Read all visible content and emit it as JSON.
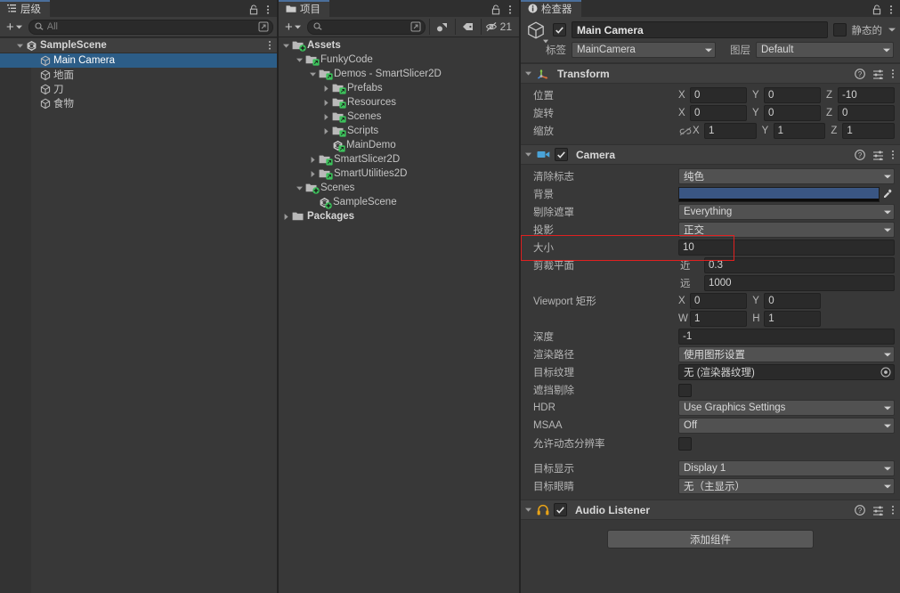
{
  "hierarchy": {
    "tab_label": "层级",
    "tab_icon": "hierarchy-icon",
    "lock_icon": "lock-icon",
    "menu_icon": "kebab-menu-icon",
    "create_label": "+",
    "search_placeholder": "All",
    "search_value": "",
    "items": [
      {
        "label": "SampleScene",
        "icon": "unity-scene-icon",
        "depth": 0,
        "expanded": true,
        "selected": false,
        "bold": true
      },
      {
        "label": "Main Camera",
        "icon": "gameobject-cube-icon",
        "depth": 1,
        "expanded": null,
        "selected": true,
        "bold": false
      },
      {
        "label": "地面",
        "icon": "gameobject-cube-icon",
        "depth": 1,
        "expanded": null,
        "selected": false,
        "bold": false
      },
      {
        "label": "刀",
        "icon": "gameobject-cube-icon",
        "depth": 1,
        "expanded": null,
        "selected": false,
        "bold": false
      },
      {
        "label": "食物",
        "icon": "gameobject-cube-icon",
        "depth": 1,
        "expanded": null,
        "selected": false,
        "bold": false
      }
    ]
  },
  "project": {
    "tab_label": "项目",
    "tab_icon": "folder-icon",
    "lock_icon": "lock-icon",
    "menu_icon": "kebab-menu-icon",
    "create_label": "+",
    "search_placeholder": "",
    "search_value": "",
    "toolbar_icons": [
      "search-expand-icon",
      "filter-by-type-icon",
      "filter-by-label-icon"
    ],
    "hidden_count": "21",
    "hidden_count_icon": "eye-slash-icon",
    "items": [
      {
        "label": "Assets",
        "icon": "folder-assets-icon",
        "depth": 0,
        "expanded": true,
        "bold": true
      },
      {
        "label": "FunkyCode",
        "icon": "folder-package-icon",
        "depth": 1,
        "expanded": true,
        "bold": false
      },
      {
        "label": "Demos - SmartSlicer2D",
        "icon": "folder-package-icon",
        "depth": 2,
        "expanded": true,
        "bold": false
      },
      {
        "label": "Prefabs",
        "icon": "folder-package-icon",
        "depth": 3,
        "expanded": false,
        "bold": false
      },
      {
        "label": "Resources",
        "icon": "folder-package-icon",
        "depth": 3,
        "expanded": false,
        "bold": false
      },
      {
        "label": "Scenes",
        "icon": "folder-package-icon",
        "depth": 3,
        "expanded": false,
        "bold": false
      },
      {
        "label": "Scripts",
        "icon": "folder-package-icon",
        "depth": 3,
        "expanded": false,
        "bold": false
      },
      {
        "label": "MainDemo",
        "icon": "unity-scene-icon",
        "depth": 3,
        "expanded": null,
        "bold": false
      },
      {
        "label": "SmartSlicer2D",
        "icon": "folder-package-icon",
        "depth": 2,
        "expanded": false,
        "bold": false
      },
      {
        "label": "SmartUtilities2D",
        "icon": "folder-package-icon",
        "depth": 2,
        "expanded": false,
        "bold": false
      },
      {
        "label": "Scenes",
        "icon": "folder-assets-icon",
        "depth": 1,
        "expanded": true,
        "bold": false
      },
      {
        "label": "SampleScene",
        "icon": "unity-scene-icon",
        "depth": 2,
        "expanded": null,
        "bold": false
      },
      {
        "label": "Packages",
        "icon": "folder-plain-icon",
        "depth": 0,
        "expanded": false,
        "bold": true
      }
    ]
  },
  "inspector": {
    "tab_label": "检查器",
    "tab_icon": "info-icon",
    "lock_icon": "lock-icon",
    "menu_icon": "kebab-menu-icon",
    "gameobject": {
      "icon": "gameobject-cube-icon",
      "enabled": true,
      "name": "Main Camera",
      "static_label": "静态的",
      "static_checked": false,
      "tag_label": "标签",
      "tag_value": "MainCamera",
      "layer_label": "图层",
      "layer_value": "Default"
    },
    "components": [
      {
        "name": "Transform",
        "icon": "transform-icon",
        "has_checkbox": false,
        "header_icons": [
          "help-icon",
          "preset-icon",
          "kebab-menu-icon"
        ],
        "rows": [
          {
            "type": "vector3",
            "label": "位置",
            "axes": [
              "X",
              "Y",
              "Z"
            ],
            "values": [
              "0",
              "0",
              "-10"
            ],
            "link": false
          },
          {
            "type": "vector3",
            "label": "旋转",
            "axes": [
              "X",
              "Y",
              "Z"
            ],
            "values": [
              "0",
              "0",
              "0"
            ],
            "link": false
          },
          {
            "type": "vector3",
            "label": "缩放",
            "axes": [
              "X",
              "Y",
              "Z"
            ],
            "values": [
              "1",
              "1",
              "1"
            ],
            "link": true,
            "link_icon": "link-broken-icon"
          }
        ]
      },
      {
        "name": "Camera",
        "icon": "camera-icon",
        "has_checkbox": true,
        "enabled": true,
        "header_icons": [
          "help-icon",
          "preset-icon",
          "kebab-menu-icon"
        ],
        "rows": [
          {
            "type": "dropdown",
            "label": "清除标志",
            "value": "纯色"
          },
          {
            "type": "color",
            "label": "背景",
            "color": "#3a5683",
            "eyedropper_icon": "eyedropper-icon"
          },
          {
            "type": "dropdown",
            "label": "剔除遮罩",
            "value": "Everything"
          },
          {
            "type": "dropdown",
            "label": "投影",
            "value": "正交",
            "highlighted": true
          },
          {
            "type": "number",
            "label": "大小",
            "value": "10"
          },
          {
            "type": "sub",
            "label": "剪裁平面",
            "sub_label": "近",
            "value": "0.3"
          },
          {
            "type": "sub",
            "label": "",
            "sub_label": "远",
            "value": "1000"
          },
          {
            "type": "pair",
            "label": "Viewport 矩形",
            "axes": [
              "X",
              "Y"
            ],
            "values": [
              "0",
              "0"
            ]
          },
          {
            "type": "pair",
            "label": "",
            "axes": [
              "W",
              "H"
            ],
            "values": [
              "1",
              "1"
            ]
          },
          {
            "type": "number",
            "label": "深度",
            "value": "-1"
          },
          {
            "type": "dropdown",
            "label": "渲染路径",
            "value": "使用图形设置"
          },
          {
            "type": "object",
            "label": "目标纹理",
            "value": "无 (渲染器纹理)",
            "picker_icon": "object-picker-icon"
          },
          {
            "type": "checkbox",
            "label": "遮挡剔除",
            "checked": false
          },
          {
            "type": "dropdown",
            "label": "HDR",
            "value": "Use Graphics Settings"
          },
          {
            "type": "dropdown",
            "label": "MSAA",
            "value": "Off"
          },
          {
            "type": "checkbox",
            "label": "允许动态分辨率",
            "checked": false
          },
          {
            "type": "gap"
          },
          {
            "type": "dropdown",
            "label": "目标显示",
            "value": "Display 1"
          },
          {
            "type": "dropdown",
            "label": "目标眼睛",
            "value": "无（主显示）"
          }
        ]
      },
      {
        "name": "Audio Listener",
        "icon": "headphones-icon",
        "has_checkbox": true,
        "enabled": true,
        "header_icons": [
          "help-icon",
          "preset-icon",
          "kebab-menu-icon"
        ],
        "rows": []
      }
    ],
    "add_component_label": "添加组件"
  },
  "annotation": {
    "highlight_color": "#e02020",
    "target": "投影"
  }
}
